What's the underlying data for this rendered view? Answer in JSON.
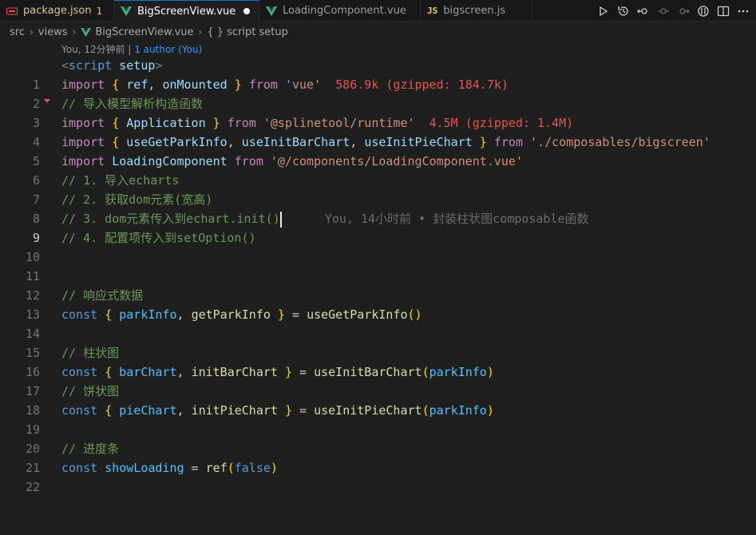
{
  "tabs": [
    {
      "label": "package.json",
      "badge": "1",
      "icon": "json-icon"
    },
    {
      "label": "BigScreenView.vue",
      "icon": "vue-icon",
      "dirty": true
    },
    {
      "label": "LoadingComponent.vue",
      "icon": "vue-icon"
    },
    {
      "label": "bigscreen.js",
      "icon": "js-icon",
      "icon_text": "JS"
    }
  ],
  "toolbar_icons": [
    "run-icon",
    "timeline-icon",
    "go-back-icon",
    "commit-prev-icon",
    "commit-next-icon",
    "git-compare-icon",
    "split-editor-icon",
    "more-actions-icon"
  ],
  "breadcrumb": {
    "items": [
      "src",
      "views",
      "BigScreenView.vue",
      "{ } script setup"
    ]
  },
  "codelens": {
    "prefix": "You, 12分钟前 | ",
    "author": "1 author (You)"
  },
  "blame": {
    "line": 9,
    "text": "You, 14小时前 • 封装柱状图composable函数"
  },
  "colors": {
    "background": "#1f1f1f",
    "tab_bar": "#181818",
    "comment": "#6a9955",
    "keyword": "#569cd6",
    "import_keyword": "#c586c0",
    "string": "#ce9178",
    "function": "#dcdcaa",
    "variable": "#9cdcfe",
    "import_size": "#e45649",
    "brace_gold": "#ffd700",
    "brace_purple": "#da70d6"
  },
  "code": {
    "line_numbers": [
      "1",
      "2",
      "3",
      "4",
      "5",
      "6",
      "7",
      "8",
      "9",
      "10",
      "11",
      "12",
      "13",
      "14",
      "15",
      "16",
      "17",
      "18",
      "19",
      "20",
      "21",
      "22"
    ],
    "current_line": 9,
    "t": {
      "l1_lt": "<",
      "l1_tag": "script",
      "l1_attr": "setup",
      "l1_gt": ">",
      "import": "import",
      "from": "from",
      "const": "const",
      "brace_open": "{ ",
      "brace_close": " }",
      "comma": ", ",
      "eq": " = ",
      "paren_open": "(",
      "paren_close": ")",
      "empty_parens": "()",
      "l2_ref": "ref",
      "l2_onMounted": "onMounted",
      "l2_str": "'vue'",
      "l2_size": "586.9k (gzipped: 184.7k)",
      "l3": "// 导入模型解析构造函数",
      "l4_app": "Application",
      "l4_str": "'@splinetool/runtime'",
      "l4_size": "4.5M (gzipped: 1.4M)",
      "l5_a": "useGetParkInfo",
      "l5_b": "useInitBarChart",
      "l5_c": "useInitPieChart",
      "l5_str": "'./composables/bigscreen'",
      "l6_name": "LoadingComponent",
      "l6_str": "'@/components/LoadingComponent.vue'",
      "l7": "// 1. 导入echarts",
      "l8": "// 2. 获取dom元素(宽高)",
      "l9": "// 3. dom元素传入到echart.init()",
      "l10": "// 4. 配置项传入到setOption()",
      "l13": "// 响应式数据",
      "l14_a": "parkInfo",
      "l14_b": "getParkInfo",
      "l14_fn": "useGetParkInfo",
      "l16": "// 柱状图",
      "l17_a": "barChart",
      "l17_b": "initBarChart",
      "l17_fn": "useInitBarChart",
      "l17_arg": "parkInfo",
      "l18": "// 饼状图",
      "l19_a": "pieChart",
      "l19_b": "initPieChart",
      "l19_fn": "useInitPieChart",
      "l19_arg": "parkInfo",
      "l21": "// 进度条",
      "l22_name": "showLoading",
      "l22_fn": "ref",
      "l22_val": "false"
    }
  }
}
